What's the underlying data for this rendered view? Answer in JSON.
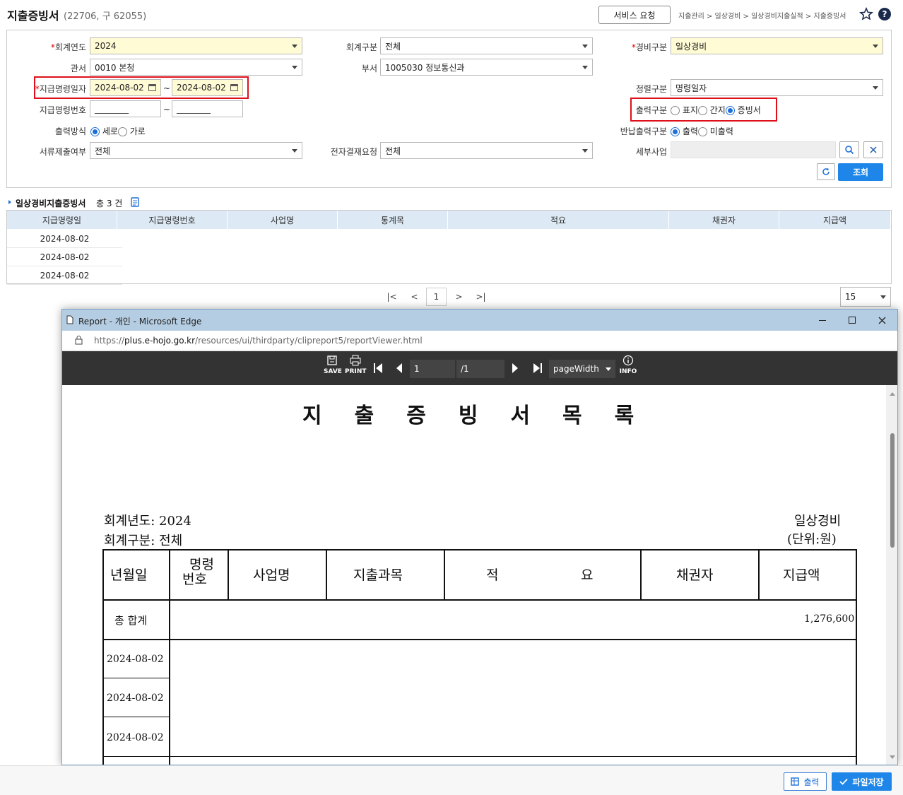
{
  "header": {
    "title": "지출증빙서",
    "subtitle": "(22706, 구 62055)",
    "service_button": "서비스 요청",
    "breadcrumb": "지출관리 > 일상경비 > 일상경비지출실적 > 지출증빙서",
    "help": "?"
  },
  "form": {
    "fiscal_year": {
      "label": "회계연도",
      "value": "2024"
    },
    "account_type": {
      "label": "회계구분",
      "value": "전체"
    },
    "expense_type": {
      "label": "경비구분",
      "value": "일상경비"
    },
    "office": {
      "label": "관서",
      "value": "0010 본청"
    },
    "dept": {
      "label": "부서",
      "value": "1005030 정보통신과"
    },
    "pay_date": {
      "label": "지급명령일자",
      "from": "2024-08-02",
      "to": "2024-08-02",
      "sep": "~"
    },
    "sort": {
      "label": "정렬구분",
      "value": "명령일자"
    },
    "pay_no": {
      "label": "지급명령번호",
      "from": "________",
      "to": "________",
      "sep": "~"
    },
    "output_kind": {
      "label": "출력구분",
      "options": [
        "표지",
        "간지",
        "증빙서"
      ],
      "selected": "증빙서"
    },
    "output_method": {
      "label": "출력방식",
      "options": [
        "세로",
        "가로"
      ],
      "selected": "세로"
    },
    "return_output": {
      "label": "반납출력구분",
      "options": [
        "출력",
        "미출력"
      ],
      "selected": "출력"
    },
    "doc_submit": {
      "label": "서류제출여부",
      "value": "전체"
    },
    "e_approval": {
      "label": "전자결재요청",
      "value": "전체"
    },
    "sub_project": {
      "label": "세부사업",
      "value": ""
    },
    "search_button": "조회"
  },
  "list": {
    "title": "일상경비지출증빙서",
    "count_text": "총 3 건",
    "columns": [
      "지급명령일",
      "지급명령번호",
      "사업명",
      "통계목",
      "적요",
      "채권자",
      "지급액"
    ],
    "rows": [
      "2024-08-02",
      "2024-08-02",
      "2024-08-02"
    ]
  },
  "pager": {
    "current": "1",
    "page_size": "15"
  },
  "edge": {
    "title": "Report - 개인 - Microsoft Edge",
    "url_prefix": "https://",
    "url_host": "plus.e-hojo.go.kr",
    "url_path": "/resources/ui/thirdparty/clipreport5/reportViewer.html",
    "save": "SAVE",
    "print": "PRINT",
    "page": "1",
    "total": "/1",
    "zoom": "pageWidth",
    "info": "INFO"
  },
  "report": {
    "title_chars": [
      "지",
      "출",
      "증",
      "빙",
      "서",
      "목",
      "록"
    ],
    "fiscal_year": "회계년도: 2024",
    "account": "회계구분: 전체",
    "expense": "일상경비",
    "unit": "(단위:원)",
    "columns": {
      "date": "년월일",
      "no1": "명령",
      "no2": "번호",
      "project": "사업명",
      "subject": "지출과목",
      "memo1": "적",
      "memo2": "요",
      "creditor": "채권자",
      "amount": "지급액"
    },
    "total_label": "총 합계",
    "total_value": "1,276,600",
    "rows": [
      "2024-08-02",
      "2024-08-02",
      "2024-08-02"
    ]
  },
  "bottom": {
    "print": "출력",
    "save_file": "파일저장"
  }
}
